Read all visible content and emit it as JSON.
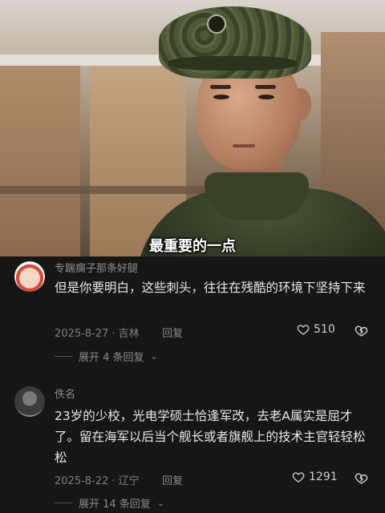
{
  "video": {
    "subtitle": "最重要的一点"
  },
  "comments": [
    {
      "username": "专踹瘸子那条好腿",
      "text": "但是你要明白，这些刺头，往往在残酷的环境下坚持下来",
      "date_location": "2025-8-27 · 吉林",
      "reply_label": "回复",
      "likes": "510",
      "expand_label": "展开 4 条回复"
    },
    {
      "username": "佚名",
      "text": "23岁的少校，光电学硕士恰逢军改，去老A属实是屈才了。留在海军以后当个舰长或者旗舰上的技术主官轻轻松松",
      "date_location": "2025-8-22 · 辽宁",
      "reply_label": "回复",
      "likes": "1291",
      "expand_label": "展开 14 条回复"
    }
  ],
  "icons": {
    "like": "heart-outline-icon",
    "dislike": "broken-heart-icon",
    "expand": "chevron-down-icon"
  }
}
